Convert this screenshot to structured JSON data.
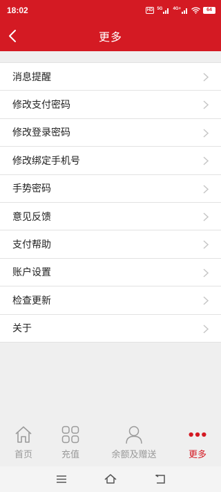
{
  "status_bar": {
    "time": "18:02",
    "hd_label": "HD",
    "sig1_label": "5G",
    "sig2_label": "4G+",
    "battery": "64"
  },
  "nav": {
    "title": "更多"
  },
  "menu": {
    "items": [
      {
        "label": "消息提醒"
      },
      {
        "label": "修改支付密码"
      },
      {
        "label": "修改登录密码"
      },
      {
        "label": "修改绑定手机号"
      },
      {
        "label": "手势密码"
      },
      {
        "label": "意见反馈"
      },
      {
        "label": "支付帮助"
      },
      {
        "label": "账户设置"
      },
      {
        "label": "检查更新"
      },
      {
        "label": "关于"
      }
    ]
  },
  "tabs": [
    {
      "label": "首页",
      "icon": "home-icon",
      "active": false
    },
    {
      "label": "充值",
      "icon": "grid-icon",
      "active": false
    },
    {
      "label": "余额及赠送",
      "icon": "user-icon",
      "active": false
    },
    {
      "label": "更多",
      "icon": "more-dots-icon",
      "active": true
    }
  ],
  "colors": {
    "brand": "#d41a23",
    "background": "#efefef",
    "inactive_tab": "#999999"
  }
}
